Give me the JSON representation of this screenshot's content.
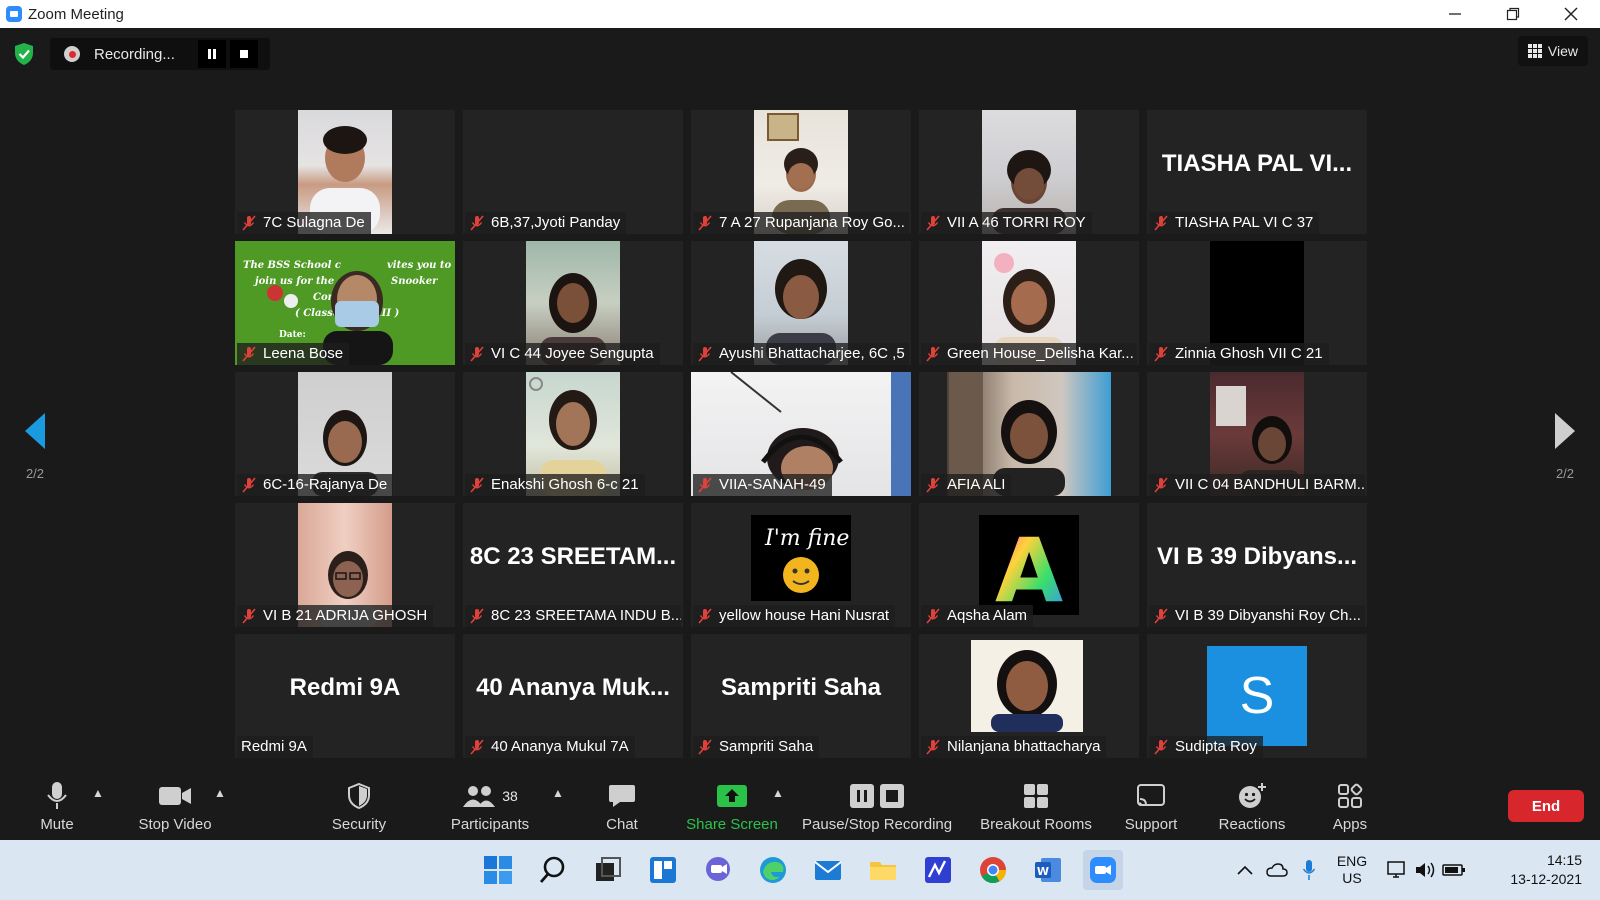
{
  "window": {
    "title": "Zoom Meeting"
  },
  "recording": {
    "status": "Recording..."
  },
  "view": {
    "label": "View"
  },
  "pagination": {
    "left": "2/2",
    "right": "2/2"
  },
  "participants": [
    {
      "name": "7C Sulagna De",
      "big": ""
    },
    {
      "name": "6B,37,Jyoti Panday",
      "big": ""
    },
    {
      "name": "7 A 27 Rupanjana Roy Go...",
      "big": ""
    },
    {
      "name": "VII A 46 TORRI ROY",
      "big": ""
    },
    {
      "name": "TIASHA PAL VI C 37",
      "big": "TIASHA PAL VI..."
    },
    {
      "name": "Leena Bose",
      "big": ""
    },
    {
      "name": "VI C 44 Joyee Sengupta",
      "big": ""
    },
    {
      "name": "Ayushi Bhattacharjee, 6C ,5",
      "big": ""
    },
    {
      "name": "Green House_Delisha Kar...",
      "big": ""
    },
    {
      "name": "Zinnia Ghosh VII C 21",
      "big": ""
    },
    {
      "name": "6C-16-Rajanya De",
      "big": ""
    },
    {
      "name": "Enakshi Ghosh 6-c 21",
      "big": ""
    },
    {
      "name": "VIIA-SANAH-49",
      "big": ""
    },
    {
      "name": "AFIA ALI",
      "big": ""
    },
    {
      "name": "VII C 04 BANDHULI BARM...",
      "big": ""
    },
    {
      "name": "VI B 21 ADRIJA GHOSH",
      "big": ""
    },
    {
      "name": "8C 23 SREETAMA INDU B...",
      "big": "8C 23 SREETAM..."
    },
    {
      "name": "yellow house Hani Nusrat",
      "big": ""
    },
    {
      "name": "Aqsha Alam",
      "big": ""
    },
    {
      "name": "VI B 39 Dibyanshi Roy Ch...",
      "big": "VI B 39 Dibyans..."
    },
    {
      "name": "Redmi 9A",
      "big": "Redmi 9A"
    },
    {
      "name": "40 Ananya Mukul 7A",
      "big": "40 Ananya Muk..."
    },
    {
      "name": "Sampriti Saha",
      "big": "Sampriti Saha"
    },
    {
      "name": "Nilanjana bhattacharya",
      "big": ""
    },
    {
      "name": "Sudipta Roy",
      "big": ""
    }
  ],
  "tile_text": {
    "banner_line1": "The BSS School c",
    "banner_line1b": "vites you to",
    "banner_line2": "join us for the",
    "banner_line2b": "Snooker",
    "banner_line3": "Con",
    "banner_line4": "( Classe",
    "banner_line4b": "III )",
    "banner_line5": "Date:",
    "fine_text": "I'm fine",
    "avatar_letter": "S",
    "a_letter": "A"
  },
  "toolbar": {
    "mute": "Mute",
    "stop_video": "Stop Video",
    "security": "Security",
    "participants": "Participants",
    "participants_count": "38",
    "chat": "Chat",
    "share_screen": "Share Screen",
    "pause_stop_recording": "Pause/Stop Recording",
    "breakout_rooms": "Breakout Rooms",
    "support": "Support",
    "reactions": "Reactions",
    "apps": "Apps",
    "end": "End"
  },
  "taskbar": {
    "lang_line1": "ENG",
    "lang_line2": "US",
    "time": "14:15",
    "date": "13-12-2021"
  },
  "colors": {
    "accent_green": "#2bc24a",
    "end_red": "#d8272c",
    "mute_red": "#e0413b",
    "zoom_blue": "#2d8cff",
    "nav_blue": "#1a9be0"
  }
}
